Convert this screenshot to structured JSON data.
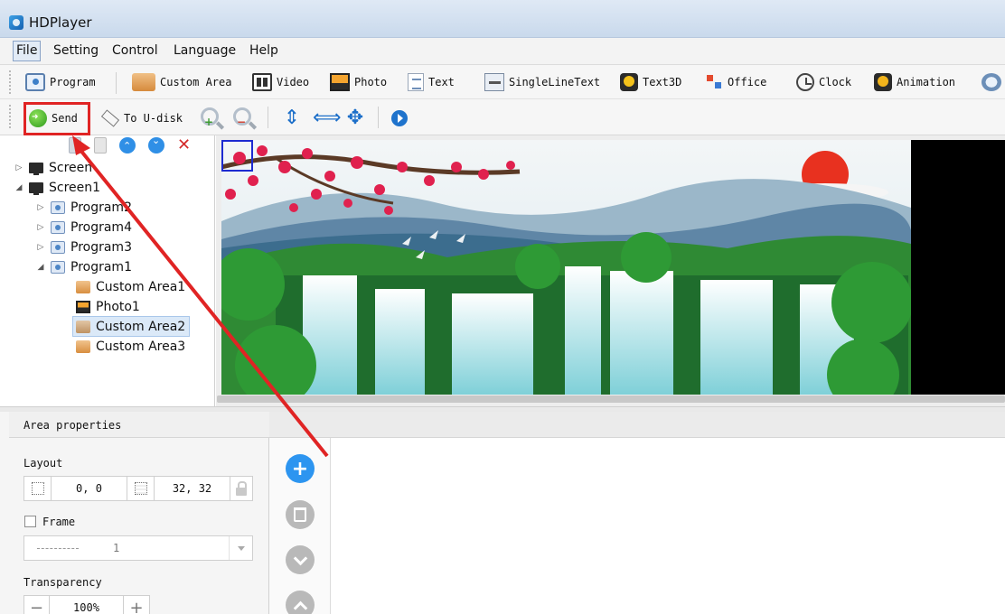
{
  "window": {
    "title": "HDPlayer"
  },
  "menu": {
    "file": "File",
    "setting": "Setting",
    "control": "Control",
    "language": "Language",
    "help": "Help"
  },
  "toolbar1": {
    "program": "Program",
    "custom_area": "Custom Area",
    "video": "Video",
    "photo": "Photo",
    "text": "Text",
    "single_line_text": "SingleLineText",
    "text3d": "Text3D",
    "office": "Office",
    "clock": "Clock",
    "animation": "Animation"
  },
  "toolbar2": {
    "send": "Send",
    "to_udisk": "To U-disk"
  },
  "tree": {
    "screen0": "Screen",
    "screen1": "Screen1",
    "program2": "Program2",
    "program4": "Program4",
    "program3": "Program3",
    "program1": "Program1",
    "area1": "Custom Area1",
    "photo1": "Photo1",
    "area2": "Custom Area2",
    "area3": "Custom Area3"
  },
  "props": {
    "header": "Area properties",
    "layout_label": "Layout",
    "position": "0, 0",
    "size": "32, 32",
    "frame_label": "Frame",
    "frame_value": "1",
    "transparency_label": "Transparency",
    "transparency_value": "100%"
  },
  "colors": {
    "accent": "#2d95f0",
    "highlight": "#e02424",
    "selection": "#1d2bd1"
  }
}
